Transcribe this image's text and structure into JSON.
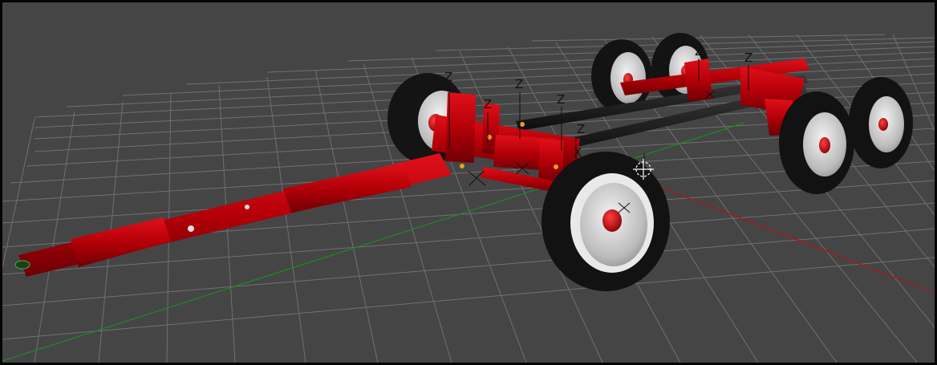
{
  "viewport": {
    "background": "#454545",
    "grid_color": "#7a7a7a",
    "x_axis_color": "#b01515",
    "y_axis_color": "#1f8a1f",
    "model_color": "#c00008",
    "tire_color": "#121212",
    "rim_color": "#d8d8d8"
  },
  "gizmos": {
    "z_label": "Z",
    "x_label": "X"
  },
  "icons": {
    "pivot": "crosshair-circle-icon"
  }
}
